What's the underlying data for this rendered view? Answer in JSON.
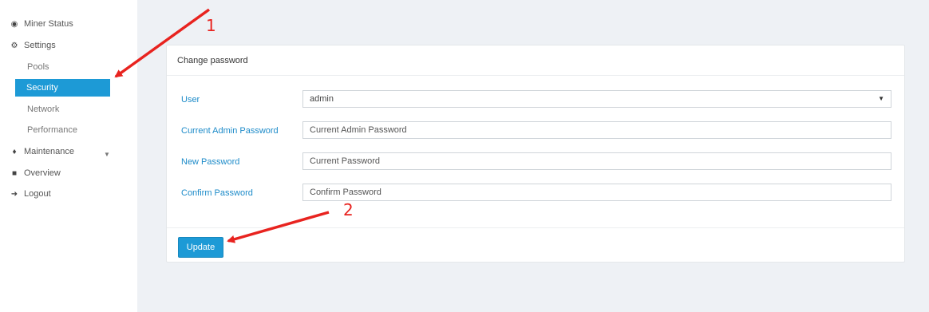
{
  "sidebar": {
    "items": [
      {
        "label": "Miner Status",
        "icon": "dashboard-icon"
      },
      {
        "label": "Settings",
        "icon": "gears-icon"
      },
      {
        "label": "Pools"
      },
      {
        "label": "Security",
        "active": true
      },
      {
        "label": "Network"
      },
      {
        "label": "Performance"
      },
      {
        "label": "Maintenance",
        "icon": "plug-icon"
      },
      {
        "label": "Overview",
        "icon": "chip-icon"
      },
      {
        "label": "Logout",
        "icon": "logout-icon"
      }
    ]
  },
  "card": {
    "title": "Change password",
    "user_label": "User",
    "user_value": "admin",
    "current_label": "Current Admin Password",
    "current_placeholder": "Current Admin Password",
    "new_label": "New Password",
    "new_placeholder": "Current Password",
    "confirm_label": "Confirm Password",
    "confirm_placeholder": "Confirm Password",
    "update_label": "Update"
  },
  "annotations": {
    "step1": "1",
    "step2": "2",
    "color": "#e8231f"
  },
  "colors": {
    "accent": "#1d9ad6",
    "label": "#1d8bc9",
    "background": "#eef1f5"
  }
}
